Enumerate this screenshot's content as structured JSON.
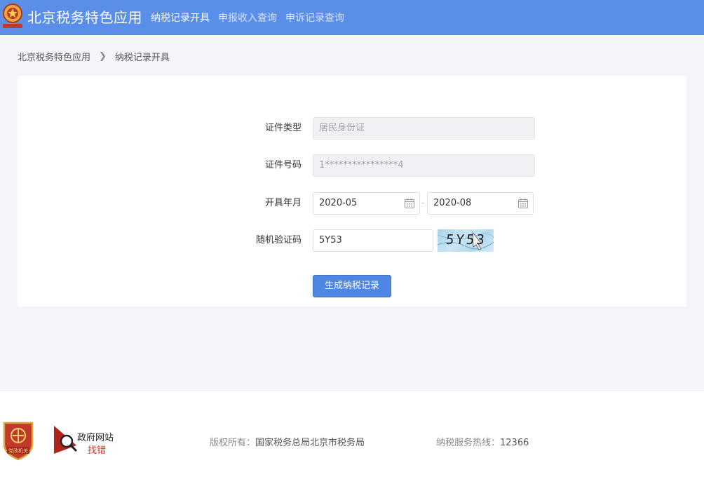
{
  "header": {
    "site_title": "北京税务特色应用",
    "nav": [
      "纳税记录开具",
      "申报收入查询",
      "申诉记录查询"
    ]
  },
  "breadcrumb": {
    "root": "北京税务特色应用",
    "current": "纳税记录开具"
  },
  "form": {
    "id_type": {
      "label": "证件类型",
      "value": "居民身份证"
    },
    "id_number": {
      "label": "证件号码",
      "value": "1****************4"
    },
    "period": {
      "label": "开具年月",
      "start": "2020-05",
      "end": "2020-08",
      "separator": "-"
    },
    "captcha": {
      "label": "随机验证码",
      "value": "5Y53",
      "image_text": "5Y53"
    },
    "submit_label": "生成纳税记录"
  },
  "footer": {
    "party_badge_text": "党政机关",
    "gov_site_line1": "政府网站",
    "gov_site_line2": "找错",
    "copyright_label": "版权所有：",
    "copyright_value": "国家税务总局北京市税务局",
    "hotline_label": "纳税服务热线：",
    "hotline_value": "12366"
  },
  "colors": {
    "header_bg": "#5a8ee8",
    "primary_button": "#4f86e3",
    "page_bg": "#f4f5f9"
  }
}
